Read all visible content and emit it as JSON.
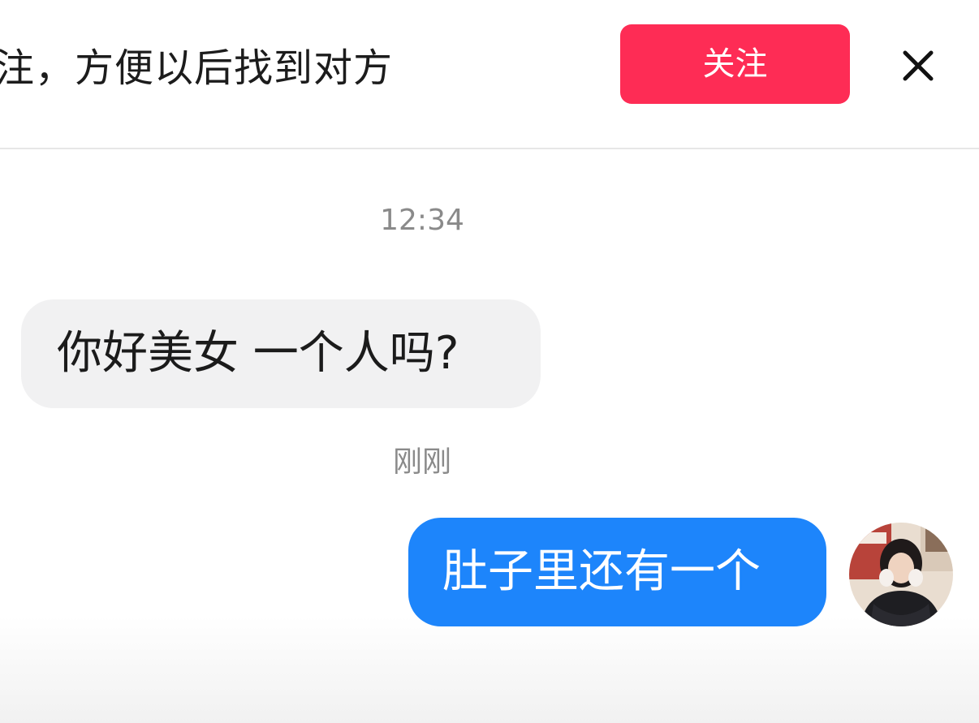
{
  "banner": {
    "text": "注，方便以后找到对方",
    "follow_label": "关注",
    "close_icon": "close-icon"
  },
  "chat": {
    "messages": [
      {
        "timestamp": "12:34",
        "direction": "incoming",
        "text": "你好美女 一个人吗?"
      },
      {
        "timestamp": "刚刚",
        "direction": "outgoing",
        "text": "肚子里还有一个"
      }
    ],
    "avatar_icon": "user-avatar"
  },
  "colors": {
    "follow_button": "#fe2c55",
    "outgoing_bubble": "#1d85fb",
    "incoming_bubble": "#f1f1f2",
    "timestamp_text": "#8a8a8a"
  }
}
